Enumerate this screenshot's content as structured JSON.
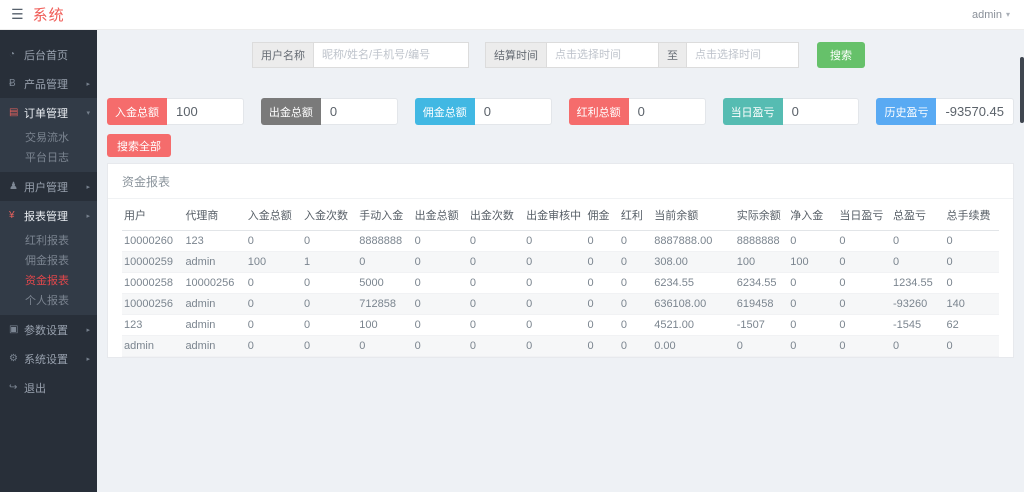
{
  "topbar": {
    "brand": "系统",
    "user": "admin"
  },
  "icons": {
    "hamburger": "☰",
    "caret_down": "▾",
    "arrow_right": "▸",
    "arrow_down": "▾",
    "dashboard": "◔",
    "product": "Ƀ",
    "orders": "▤",
    "users": "♟",
    "reports": "¥",
    "params": "▣",
    "settings": "⚙",
    "logout": "↪"
  },
  "sidebar": {
    "items": [
      {
        "label": "后台首页"
      },
      {
        "label": "产品管理"
      },
      {
        "label": "订单管理",
        "children": [
          "交易流水",
          "平台日志"
        ]
      },
      {
        "label": "用户管理"
      },
      {
        "label": "报表管理",
        "children": [
          "红利报表",
          "佣金报表",
          "资金报表",
          "个人报表"
        ],
        "active_child": "资金报表"
      },
      {
        "label": "参数设置"
      },
      {
        "label": "系统设置"
      },
      {
        "label": "退出"
      }
    ]
  },
  "filters": {
    "username_label": "用户名称",
    "username_placeholder": "昵称/姓名/手机号/编号",
    "time_label": "结算时间",
    "time_placeholder": "点击选择时间",
    "to_label": "至",
    "search_button": "搜索"
  },
  "stats": [
    {
      "label": "入金总额",
      "value": "100",
      "color": "#f56c6c"
    },
    {
      "label": "出金总额",
      "value": "0",
      "color": "#7a7a7a"
    },
    {
      "label": "佣金总额",
      "value": "0",
      "color": "#41b8e3"
    },
    {
      "label": "红利总额",
      "value": "0",
      "color": "#f56c6c"
    },
    {
      "label": "当日盈亏",
      "value": "0",
      "color": "#56bcb2"
    },
    {
      "label": "历史盈亏",
      "value": "-93570.45",
      "color": "#59aaf3"
    }
  ],
  "search_all_label": "搜索全部",
  "panel": {
    "title": "资金报表"
  },
  "table": {
    "columns": [
      "用户",
      "代理商",
      "入金总额",
      "入金次数",
      "手动入金",
      "出金总额",
      "出金次数",
      "出金审核中",
      "佣金",
      "红利",
      "当前余额",
      "实际余额",
      "净入金",
      "当日盈亏",
      "总盈亏",
      "总手续费"
    ],
    "rows": [
      [
        "10000260",
        "123",
        "0",
        "0",
        "8888888",
        "0",
        "0",
        "0",
        "0",
        "0",
        "8887888.00",
        "8888888",
        "0",
        "0",
        "0",
        "0"
      ],
      [
        "10000259",
        "admin",
        "100",
        "1",
        "0",
        "0",
        "0",
        "0",
        "0",
        "0",
        "308.00",
        "100",
        "100",
        "0",
        "0",
        "0"
      ],
      [
        "10000258",
        "10000256",
        "0",
        "0",
        "5000",
        "0",
        "0",
        "0",
        "0",
        "0",
        "6234.55",
        "6234.55",
        "0",
        "0",
        "1234.55",
        "0"
      ],
      [
        "10000256",
        "admin",
        "0",
        "0",
        "712858",
        "0",
        "0",
        "0",
        "0",
        "0",
        "636108.00",
        "619458",
        "0",
        "0",
        "-93260",
        "140"
      ],
      [
        "123",
        "admin",
        "0",
        "0",
        "100",
        "0",
        "0",
        "0",
        "0",
        "0",
        "4521.00",
        "-1507",
        "0",
        "0",
        "-1545",
        "62"
      ],
      [
        "admin",
        "admin",
        "0",
        "0",
        "0",
        "0",
        "0",
        "0",
        "0",
        "0",
        "0.00",
        "0",
        "0",
        "0",
        "0",
        "0"
      ]
    ]
  },
  "colors": {
    "brand_red": "#f05b56",
    "sidebar_bg": "#282f39",
    "sidebar_group_bg": "#323b47",
    "active_item_red": "#e0474b",
    "green_button": "#66c16a",
    "red_button": "#f56c6c",
    "main_bg": "#eef1f5"
  }
}
